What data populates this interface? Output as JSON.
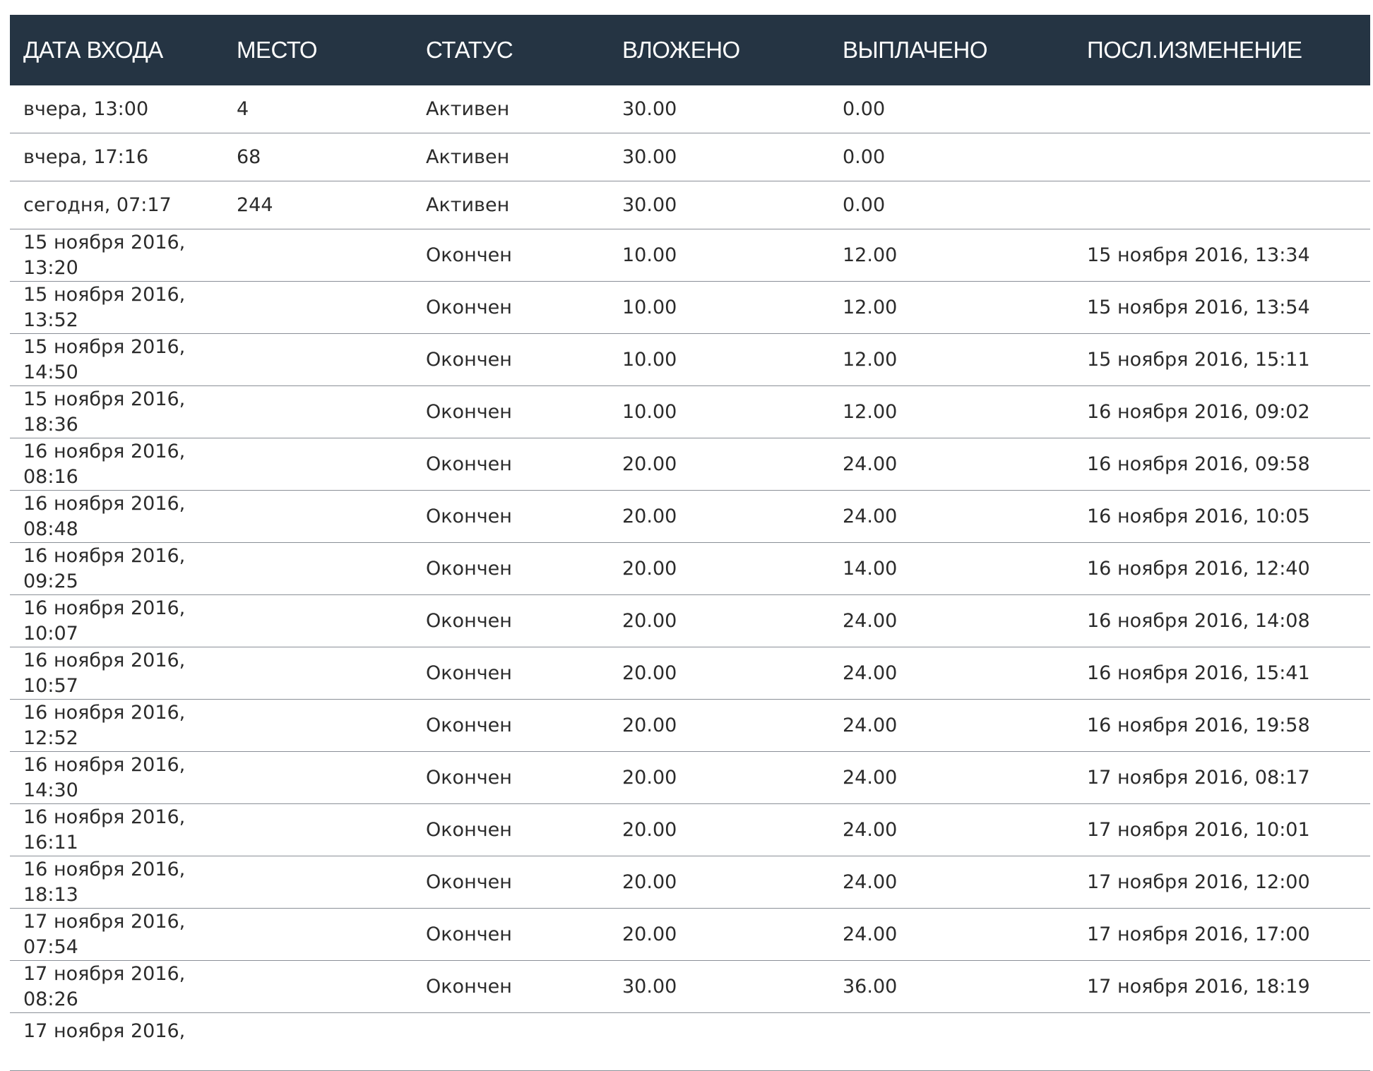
{
  "table": {
    "headers": [
      "ДАТА ВХОДА",
      "МЕСТО",
      "СТАТУС",
      "ВЛОЖЕНО",
      "ВЫПЛАЧЕНО",
      "ПОСЛ.ИЗМЕНЕНИЕ"
    ],
    "rows": [
      [
        "вчера, 13:00",
        "4",
        "Активен",
        "30.00",
        "0.00",
        ""
      ],
      [
        "вчера, 17:16",
        "68",
        "Активен",
        "30.00",
        "0.00",
        ""
      ],
      [
        "сегодня, 07:17",
        "244",
        "Активен",
        "30.00",
        "0.00",
        ""
      ],
      [
        "15 ноября 2016, 13:20",
        "",
        "Окончен",
        "10.00",
        "12.00",
        "15 ноября 2016, 13:34"
      ],
      [
        "15 ноября 2016, 13:52",
        "",
        "Окончен",
        "10.00",
        "12.00",
        "15 ноября 2016, 13:54"
      ],
      [
        "15 ноября 2016, 14:50",
        "",
        "Окончен",
        "10.00",
        "12.00",
        "15 ноября 2016, 15:11"
      ],
      [
        "15 ноября 2016, 18:36",
        "",
        "Окончен",
        "10.00",
        "12.00",
        "16 ноября 2016, 09:02"
      ],
      [
        "16 ноября 2016, 08:16",
        "",
        "Окончен",
        "20.00",
        "24.00",
        "16 ноября 2016, 09:58"
      ],
      [
        "16 ноября 2016, 08:48",
        "",
        "Окончен",
        "20.00",
        "24.00",
        "16 ноября 2016, 10:05"
      ],
      [
        "16 ноября 2016, 09:25",
        "",
        "Окончен",
        "20.00",
        "14.00",
        "16 ноября 2016, 12:40"
      ],
      [
        "16 ноября 2016, 10:07",
        "",
        "Окончен",
        "20.00",
        "24.00",
        "16 ноября 2016, 14:08"
      ],
      [
        "16 ноября 2016, 10:57",
        "",
        "Окончен",
        "20.00",
        "24.00",
        "16 ноября 2016, 15:41"
      ],
      [
        "16 ноября 2016, 12:52",
        "",
        "Окончен",
        "20.00",
        "24.00",
        "16 ноября 2016, 19:58"
      ],
      [
        "16 ноября 2016, 14:30",
        "",
        "Окончен",
        "20.00",
        "24.00",
        "17 ноября 2016, 08:17"
      ],
      [
        "16 ноября 2016, 16:11",
        "",
        "Окончен",
        "20.00",
        "24.00",
        "17 ноября 2016, 10:01"
      ],
      [
        "16 ноября 2016, 18:13",
        "",
        "Окончен",
        "20.00",
        "24.00",
        "17 ноября 2016, 12:00"
      ],
      [
        "17 ноября 2016, 07:54",
        "",
        "Окончен",
        "20.00",
        "24.00",
        "17 ноября 2016, 17:00"
      ],
      [
        "17 ноября 2016, 08:26",
        "",
        "Окончен",
        "30.00",
        "36.00",
        "17 ноября 2016, 18:19"
      ],
      [
        "17 ноября 2016,",
        "",
        "",
        "",
        "",
        ""
      ]
    ]
  },
  "colors": {
    "header_background": "#253443",
    "header_text": "#ffffff",
    "row_text": "#2b2b2b",
    "row_divider": "#8a8f97"
  }
}
